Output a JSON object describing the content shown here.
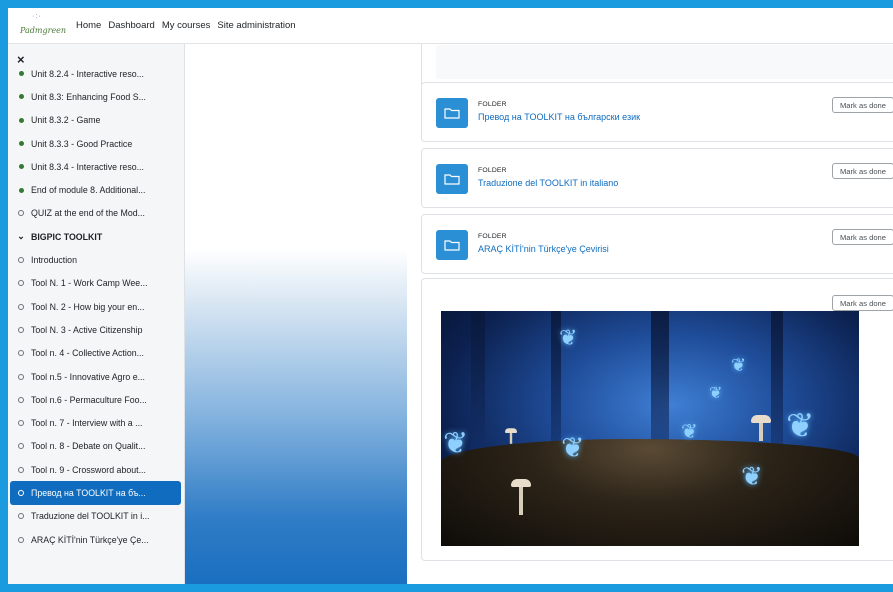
{
  "navbar": {
    "logo_text": "Padmgreen",
    "links": [
      "Home",
      "Dashboard",
      "My courses",
      "Site administration"
    ]
  },
  "sidebar": {
    "close_glyph": "×",
    "items": [
      {
        "label": "Unit 8.2.4 - Interactive reso...",
        "state": "done"
      },
      {
        "label": "Unit 8.3: Enhancing Food S...",
        "state": "done"
      },
      {
        "label": "Unit 8.3.2 - Game",
        "state": "done"
      },
      {
        "label": "Unit 8.3.3 - Good Practice",
        "state": "done"
      },
      {
        "label": "Unit 8.3.4 - Interactive reso...",
        "state": "done"
      },
      {
        "label": "End of module 8. Additional...",
        "state": "done"
      },
      {
        "label": "QUIZ at the end of the Mod...",
        "state": "todo"
      },
      {
        "label": "BIGPIC TOOLKIT",
        "state": "section"
      },
      {
        "label": "Introduction",
        "state": "todo"
      },
      {
        "label": "Tool N. 1 - Work Camp Wee...",
        "state": "todo"
      },
      {
        "label": "Tool N. 2 - How big your en...",
        "state": "todo"
      },
      {
        "label": "Tool N. 3 - Active Citizenship",
        "state": "todo"
      },
      {
        "label": "Tool n. 4 - Collective Action...",
        "state": "todo"
      },
      {
        "label": "Tool n.5 - Innovative Agro e...",
        "state": "todo"
      },
      {
        "label": "Tool n.6 - Permaculture Foo...",
        "state": "todo"
      },
      {
        "label": "Tool n. 7 - Interview with a ...",
        "state": "todo"
      },
      {
        "label": "Tool n. 8 - Debate on Qualit...",
        "state": "todo"
      },
      {
        "label": "Tool n. 9 - Crossword about...",
        "state": "todo"
      },
      {
        "label": "Превод на TOOLKIT на бъ...",
        "state": "active"
      },
      {
        "label": "Traduzione del TOOLKIT in i...",
        "state": "todo"
      },
      {
        "label": "ARAÇ KİTİ'nin Türkçe'ye Çe...",
        "state": "todo"
      }
    ]
  },
  "activities": [
    {
      "type": "FOLDER",
      "name": "Превод на TOOLKIT на български език",
      "button": "Mark as done",
      "icon": "folder-icon"
    },
    {
      "type": "FOLDER",
      "name": "Traduzione del TOOLKIT in italiano",
      "button": "Mark as done",
      "icon": "folder-icon"
    },
    {
      "type": "FOLDER",
      "name": "ARAÇ KİTİ'nin Türkçe'ye Çevirisi",
      "button": "Mark as done",
      "icon": "folder-icon"
    }
  ],
  "image_card": {
    "button": "Mark as done",
    "image_subject": "fantasy-forest-butterflies"
  },
  "colors": {
    "accent": "#0f6cbf",
    "folder_icon_bg": "#2a8fd4",
    "done_dot": "#357a32",
    "outer_border": "#1a9be0"
  }
}
